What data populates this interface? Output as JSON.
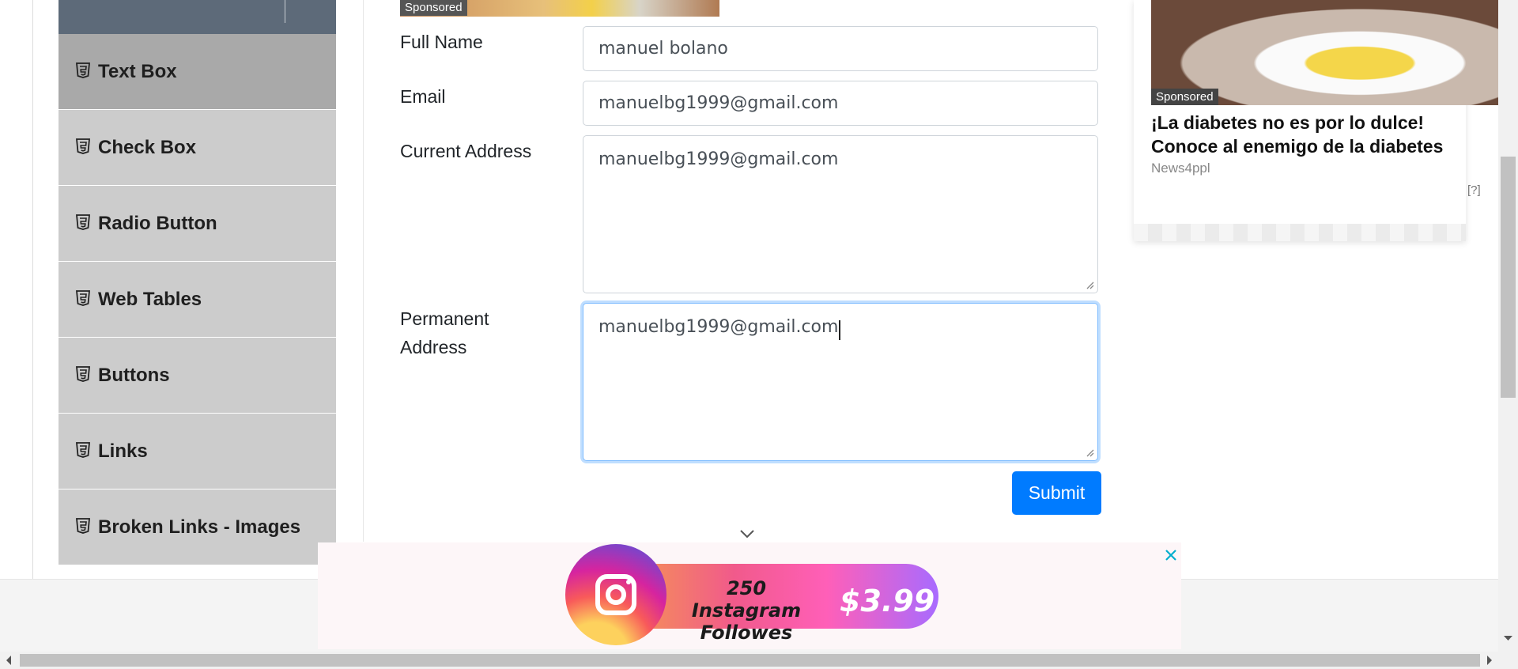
{
  "sidebar": {
    "items": [
      {
        "label": "Text Box",
        "active": true
      },
      {
        "label": "Check Box",
        "active": false
      },
      {
        "label": "Radio Button",
        "active": false
      },
      {
        "label": "Web Tables",
        "active": false
      },
      {
        "label": "Buttons",
        "active": false
      },
      {
        "label": "Links",
        "active": false
      },
      {
        "label": "Broken Links - Images",
        "active": false
      }
    ],
    "icon": "html5-icon"
  },
  "form": {
    "sponsored_label": "Sponsored",
    "full_name": {
      "label": "Full Name",
      "value": "manuel bolano"
    },
    "email": {
      "label": "Email",
      "value": "manuelbg1999@gmail.com"
    },
    "current_address": {
      "label": "Current Address",
      "value": "manuelbg1999@gmail.com"
    },
    "permanent_address": {
      "label_line1": "Permanent",
      "label_line2": "Address",
      "value": "manuelbg1999@gmail.com"
    },
    "submit_label": "Submit",
    "accent_color": "#007bff"
  },
  "right_ad": {
    "sponsored_label": "Sponsored",
    "headline_line1": "¡La diabetes no es por lo dulce!",
    "headline_line2": "Conoce al enemigo de la diabetes",
    "source": "News4ppl",
    "info": "[?]"
  },
  "banner": {
    "offer_line1": "250 Instagram",
    "offer_line2": "Followes",
    "price": "$3.99",
    "close_icon": "close-icon"
  }
}
